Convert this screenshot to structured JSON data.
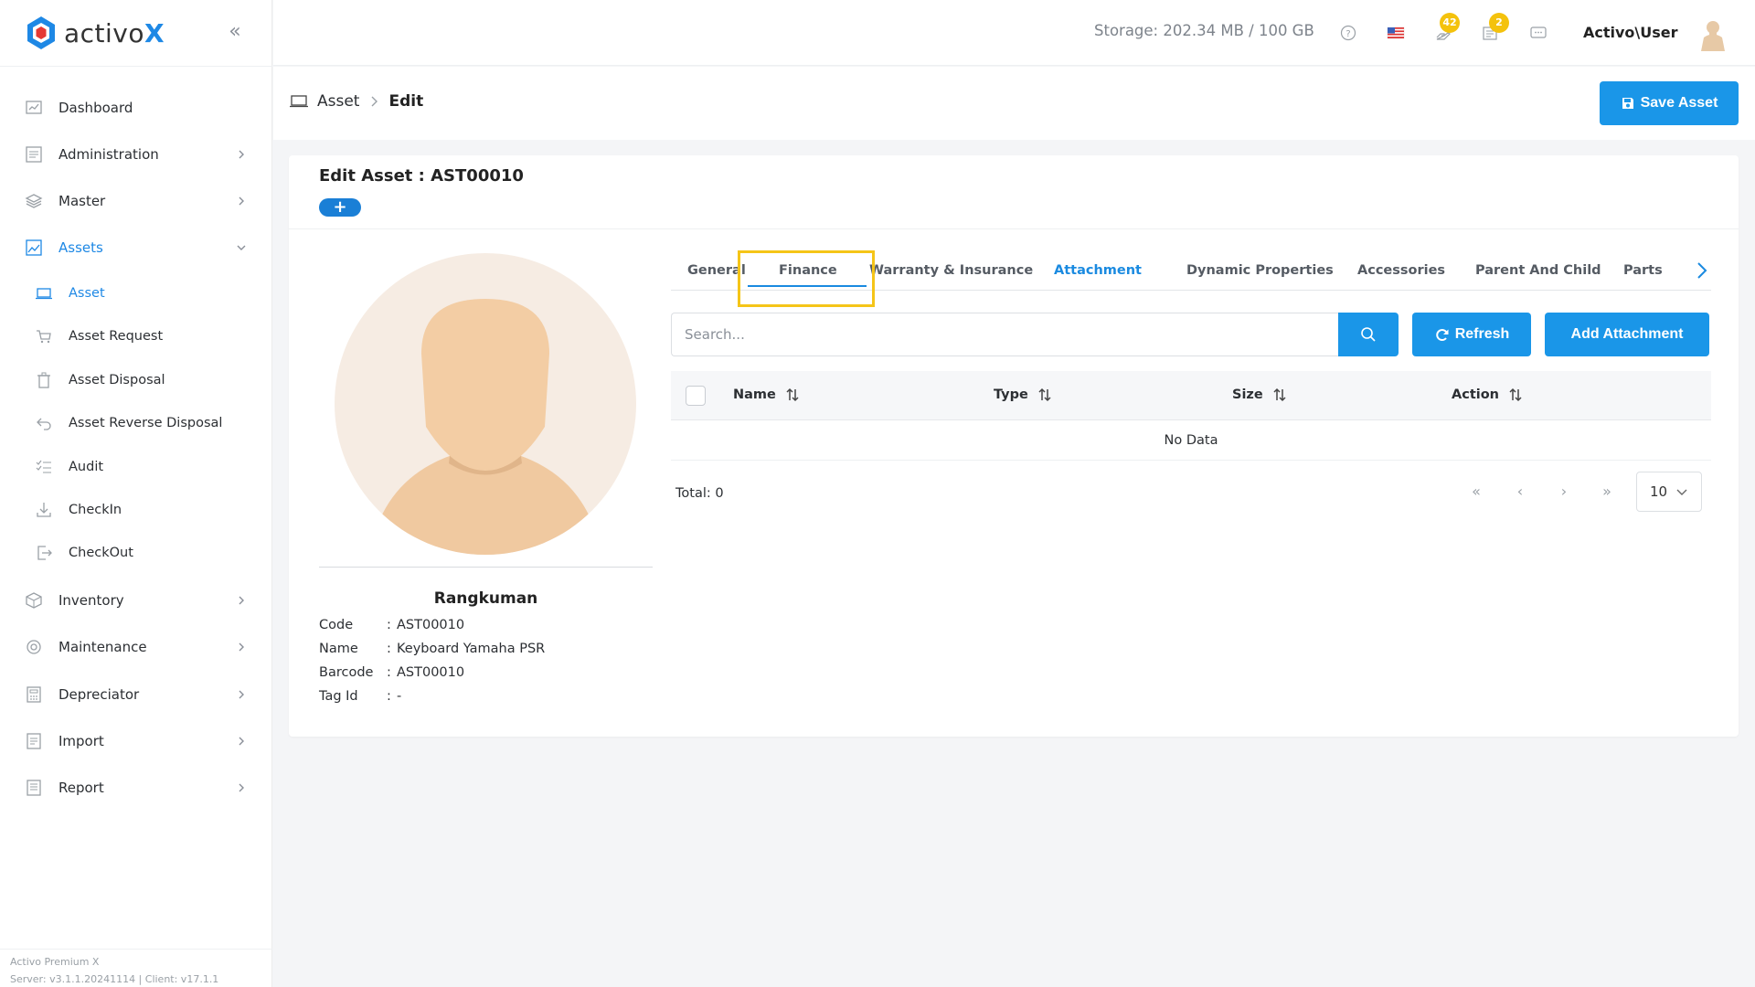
{
  "brand": {
    "name_main": "activo",
    "name_accent": "X"
  },
  "sidebar": {
    "items": [
      {
        "label": "Dashboard"
      },
      {
        "label": "Administration"
      },
      {
        "label": "Master"
      },
      {
        "label": "Assets"
      },
      {
        "label": "Inventory"
      },
      {
        "label": "Maintenance"
      },
      {
        "label": "Depreciator"
      },
      {
        "label": "Import"
      },
      {
        "label": "Report"
      }
    ],
    "asset_sub": [
      {
        "label": "Asset"
      },
      {
        "label": "Asset Request"
      },
      {
        "label": "Asset Disposal"
      },
      {
        "label": "Asset Reverse Disposal"
      },
      {
        "label": "Audit"
      },
      {
        "label": "CheckIn"
      },
      {
        "label": "CheckOut"
      }
    ],
    "footer_line1": "Activo Premium X",
    "footer_line2": "Server: v3.1.1.20241114 | Client: v17.1.1"
  },
  "topbar": {
    "storage": "Storage: 202.34 MB / 100 GB",
    "notif_count": "42",
    "task_count": "2",
    "user": "Activo\\User"
  },
  "breadcrumb": {
    "root": "Asset",
    "current": "Edit"
  },
  "save_button": "Save Asset",
  "card": {
    "title": "Edit Asset : AST00010",
    "plus": "+"
  },
  "summary": {
    "title": "Rangkuman",
    "rows": [
      {
        "key": "Code",
        "value": "AST00010"
      },
      {
        "key": "Name",
        "value": "Keyboard Yamaha PSR"
      },
      {
        "key": "Barcode",
        "value": "AST00010"
      },
      {
        "key": "Tag Id",
        "value": "-"
      }
    ]
  },
  "tabs": [
    {
      "label": "General"
    },
    {
      "label": "Finance"
    },
    {
      "label": "Warranty & Insurance"
    },
    {
      "label": "Attachment",
      "active": true
    },
    {
      "label": "Dynamic Properties"
    },
    {
      "label": "Accessories"
    },
    {
      "label": "Parent And Child"
    },
    {
      "label": "Parts"
    }
  ],
  "search": {
    "placeholder": "Search..."
  },
  "buttons": {
    "refresh": "Refresh",
    "add_attachment": "Add Attachment"
  },
  "table": {
    "columns": [
      {
        "label": "Name"
      },
      {
        "label": "Type"
      },
      {
        "label": "Size"
      },
      {
        "label": "Action"
      }
    ],
    "empty": "No Data"
  },
  "pagination": {
    "total": "Total: 0",
    "page_size": "10"
  },
  "colors": {
    "accent": "#1a96e8",
    "highlight": "#f5c518",
    "badge": "#f4c20d"
  }
}
